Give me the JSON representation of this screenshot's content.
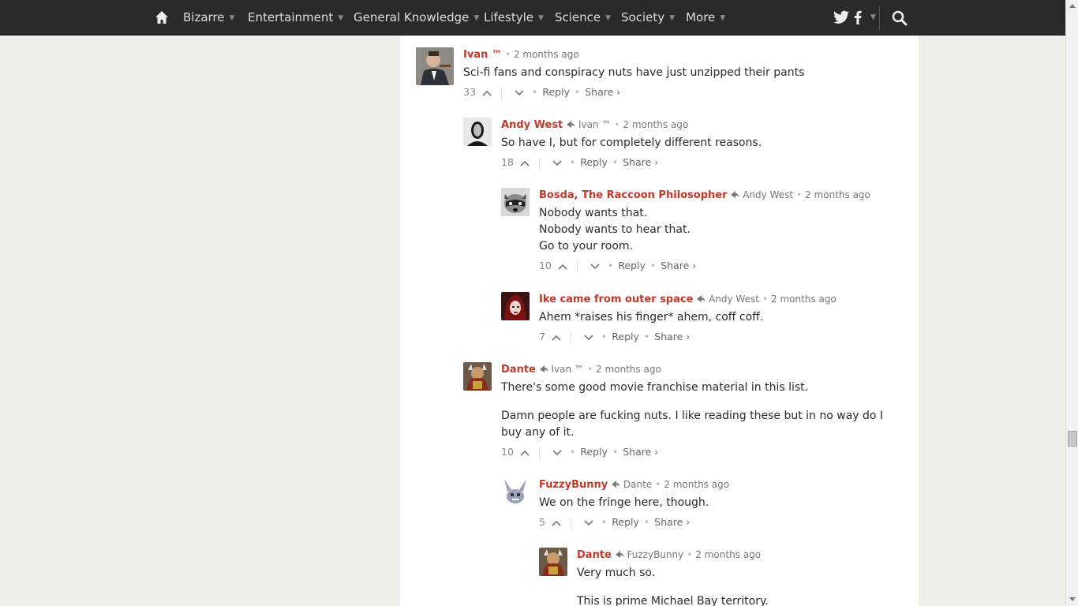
{
  "nav": {
    "items": [
      {
        "label": "Bizarre"
      },
      {
        "label": "Entertainment"
      },
      {
        "label": "General Knowledge"
      },
      {
        "label": "Lifestyle"
      },
      {
        "label": "Science"
      },
      {
        "label": "Society"
      },
      {
        "label": "More"
      }
    ],
    "icons": [
      "home-icon",
      "twitter-icon",
      "facebook-icon",
      "search-icon"
    ]
  },
  "comments": [
    {
      "author": "Ivan ™",
      "reply_to": "",
      "time": "2 months ago",
      "lines": [
        "Sci-fi fans and conspiracy nuts have just unzipped their pants"
      ],
      "votes": "33",
      "reply": "Reply",
      "share": "Share ›"
    },
    {
      "author": "Andy West",
      "reply_to": "Ivan ™",
      "time": "2 months ago",
      "lines": [
        "So have I, but for completely different reasons."
      ],
      "votes": "18",
      "reply": "Reply",
      "share": "Share ›"
    },
    {
      "author": "Bosda, The Raccoon Philosopher",
      "reply_to": "Andy West",
      "time": "2 months ago",
      "lines": [
        "Nobody wants that.",
        "Nobody wants to hear that.",
        "Go to your room."
      ],
      "votes": "10",
      "reply": "Reply",
      "share": "Share ›"
    },
    {
      "author": "Ike came from outer space",
      "reply_to": "Andy West",
      "time": "2 months ago",
      "lines": [
        "Ahem *raises his finger* ahem, coff coff."
      ],
      "votes": "7",
      "reply": "Reply",
      "share": "Share ›"
    },
    {
      "author": "Dante",
      "reply_to": "Ivan ™",
      "time": "2 months ago",
      "lines": [
        "There's some good movie franchise material in this list.",
        "Damn people are fucking nuts. I like reading these but in no way do I buy any of it."
      ],
      "votes": "10",
      "reply": "Reply",
      "share": "Share ›"
    },
    {
      "author": "FuzzyBunny",
      "reply_to": "Dante",
      "time": "2 months ago",
      "lines": [
        "We on the fringe here, though."
      ],
      "votes": "5",
      "reply": "Reply",
      "share": "Share ›"
    },
    {
      "author": "Dante",
      "reply_to": "FuzzyBunny",
      "time": "2 months ago",
      "lines": [
        "Very much so.",
        "This is prime Michael Bay territory."
      ],
      "votes": "",
      "reply": "",
      "share": ""
    }
  ]
}
